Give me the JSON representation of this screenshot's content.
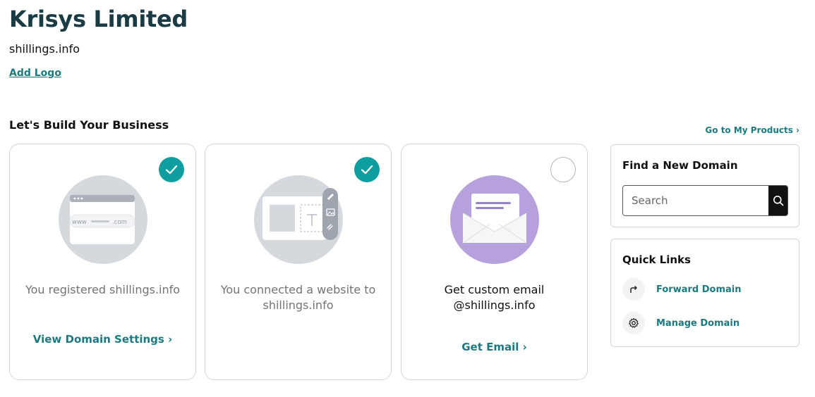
{
  "business": {
    "name": "Krisys Limited",
    "domain": "shillings.info",
    "add_logo": "Add Logo"
  },
  "section": {
    "title": "Let's Build Your Business",
    "go_to_products": "Go to My Products ›"
  },
  "cards": [
    {
      "text": "You registered shillings.info",
      "link": "View Domain Settings ›",
      "completed": true,
      "illustration": {
        "www": "www",
        "com": ".com"
      }
    },
    {
      "text": "You connected a website to shillings.info",
      "link": "",
      "completed": true
    },
    {
      "text": "Get custom email @shillings.info",
      "link": "Get Email ›",
      "completed": false
    }
  ],
  "find_domain": {
    "title": "Find a New Domain",
    "search_placeholder": "Search"
  },
  "quick_links": {
    "title": "Quick Links",
    "items": [
      {
        "label": "Forward Domain",
        "icon": "forward-arrow-icon"
      },
      {
        "label": "Manage Domain",
        "icon": "gear-icon"
      }
    ]
  },
  "colors": {
    "accent": "#1b7a80",
    "check": "#0f9ea0",
    "title": "#1a3a44",
    "email_circle": "#b7a1dc"
  }
}
